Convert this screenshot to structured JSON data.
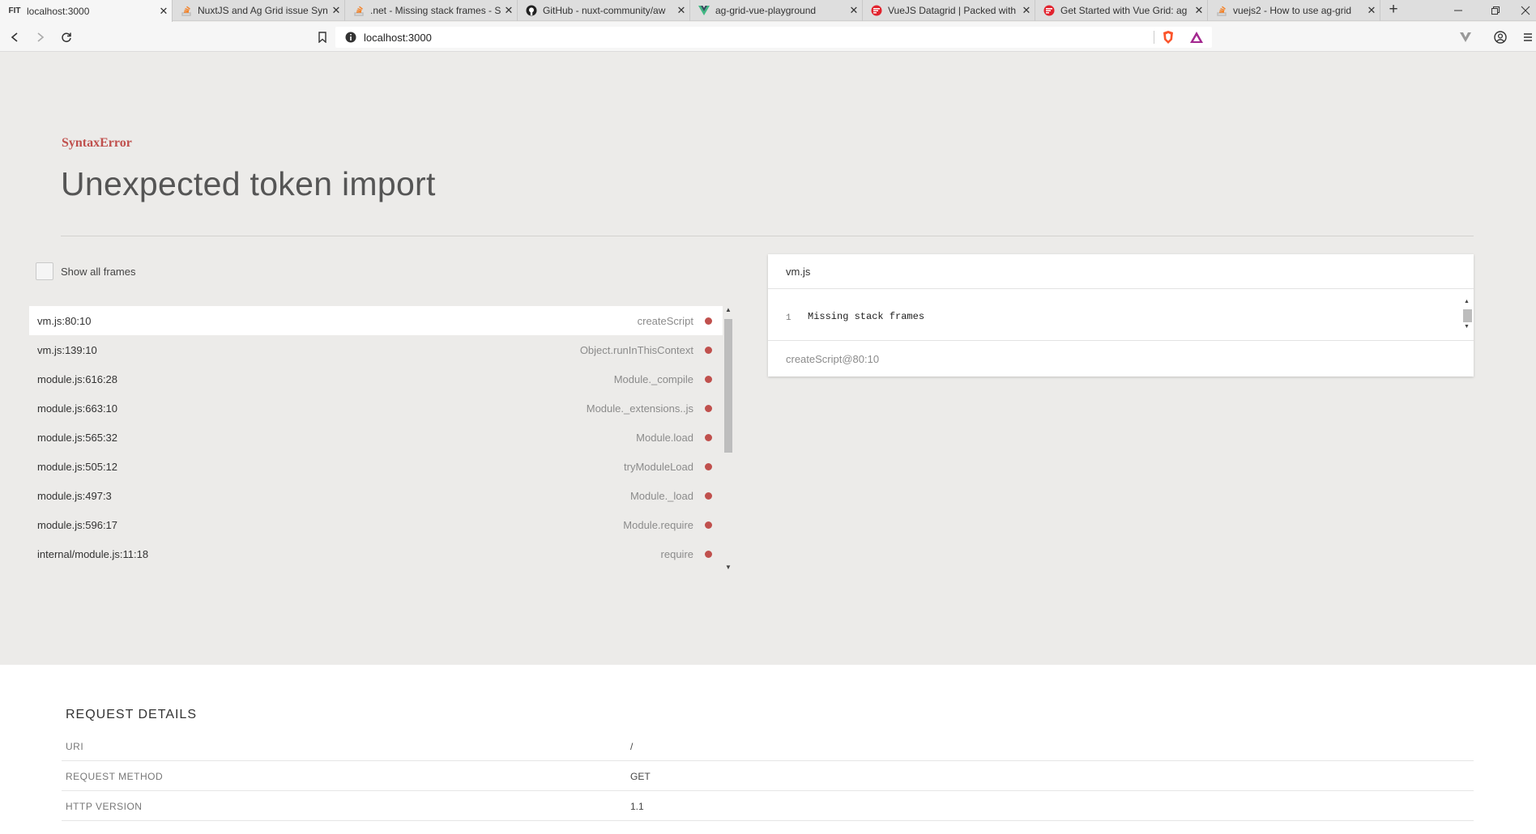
{
  "browser": {
    "tabs": [
      {
        "title": "localhost:3000",
        "favicon": "FIT",
        "active": true
      },
      {
        "title": "NuxtJS and Ag Grid issue Syn",
        "favicon": "stackoverflow-icon"
      },
      {
        "title": ".net - Missing stack frames - S",
        "favicon": "stackoverflow-icon"
      },
      {
        "title": "GitHub - nuxt-community/aw",
        "favicon": "github-icon"
      },
      {
        "title": "ag-grid-vue-playground",
        "favicon": "vue-icon"
      },
      {
        "title": "VueJS Datagrid | Packed with",
        "favicon": "ag-grid-icon"
      },
      {
        "title": "Get Started with Vue Grid: ag",
        "favicon": "ag-grid-icon"
      },
      {
        "title": "vuejs2 - How to use ag-grid",
        "favicon": "stackoverflow-icon"
      }
    ],
    "new_tab": "+",
    "close_glyph": "✕",
    "url": "localhost:3000"
  },
  "error": {
    "type": "SyntaxError",
    "message": "Unexpected token import",
    "show_frames_label": "Show all frames"
  },
  "frames": [
    {
      "file": "vm.js:80:10",
      "fn": "createScript"
    },
    {
      "file": "vm.js:139:10",
      "fn": "Object.runInThisContext"
    },
    {
      "file": "module.js:616:28",
      "fn": "Module._compile"
    },
    {
      "file": "module.js:663:10",
      "fn": "Module._extensions..js"
    },
    {
      "file": "module.js:565:32",
      "fn": "Module.load"
    },
    {
      "file": "module.js:505:12",
      "fn": "tryModuleLoad"
    },
    {
      "file": "module.js:497:3",
      "fn": "Module._load"
    },
    {
      "file": "module.js:596:17",
      "fn": "Module.require"
    },
    {
      "file": "internal/module.js:11:18",
      "fn": "require"
    }
  ],
  "code_panel": {
    "file": "vm.js",
    "line_number": "1",
    "line_text": "Missing stack frames",
    "location": "createScript@80:10"
  },
  "request_details": {
    "heading": "REQUEST DETAILS",
    "rows": [
      {
        "key": "URI",
        "value": "/"
      },
      {
        "key": "REQUEST METHOD",
        "value": "GET"
      },
      {
        "key": "HTTP VERSION",
        "value": "1.1"
      }
    ]
  },
  "colors": {
    "accent": "#c0504d",
    "page_bg": "#ecebe9"
  }
}
